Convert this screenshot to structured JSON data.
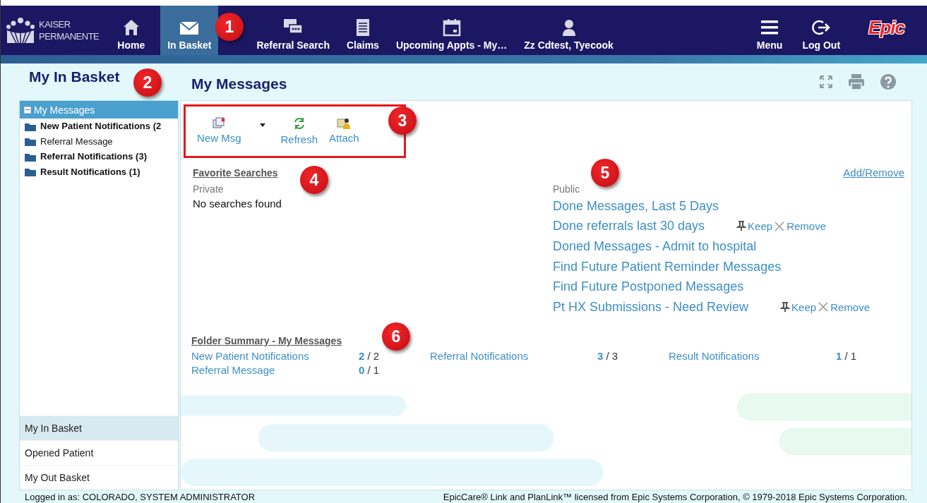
{
  "header": {
    "logo_text": "KAISER PERMANENTE",
    "nav": [
      {
        "label": "Home",
        "selected": false
      },
      {
        "label": "In Basket",
        "selected": true
      },
      {
        "label": "Referral Search",
        "selected": false
      },
      {
        "label": "Claims",
        "selected": false
      },
      {
        "label": "Upcoming Appts - My…",
        "selected": false
      },
      {
        "label": "Zz Cdtest, Tyecook",
        "selected": false
      }
    ],
    "actions": [
      {
        "label": "Menu"
      },
      {
        "label": "Log Out"
      }
    ],
    "brand": "Epic"
  },
  "sidebar": {
    "title": "My In Basket",
    "tree": [
      {
        "label": "My Messages",
        "expanded": true,
        "selected": true,
        "children": [
          {
            "label": "New Patient Notifications (2",
            "unread": true
          },
          {
            "label": "Referral Message",
            "unread": false
          },
          {
            "label": "Referral Notifications (3)",
            "unread": true
          },
          {
            "label": "Result Notifications (1)",
            "unread": true
          }
        ]
      }
    ],
    "tabs": [
      {
        "label": "My In Basket",
        "selected": true
      },
      {
        "label": "Opened Patient",
        "selected": false
      },
      {
        "label": "My Out Basket",
        "selected": false
      }
    ]
  },
  "main": {
    "title": "My Messages",
    "toolbar": {
      "highlighted": true,
      "buttons": [
        {
          "label": "New Msg",
          "has_menu": true
        },
        {
          "label": "Refresh",
          "has_menu": false
        },
        {
          "label": "Attach",
          "has_menu": false
        }
      ]
    },
    "favorite_searches": {
      "heading": "Favorite Searches",
      "add_remove": "Add/Remove",
      "private_label": "Private",
      "private_empty": "No searches found",
      "public_label": "Public",
      "public": [
        {
          "label": "Done Messages, Last 5 Days"
        },
        {
          "label": "Done referrals last 30 days",
          "keep": "Keep",
          "remove": "Remove"
        },
        {
          "label": "Doned Messages - Admit to hospital"
        },
        {
          "label": "Find Future Patient Reminder Messages"
        },
        {
          "label": "Find Future Postponed Messages"
        },
        {
          "label": "Pt HX Submissions - Need Review",
          "keep": "Keep",
          "remove": "Remove"
        }
      ]
    },
    "folder_summary": {
      "heading": "Folder Summary - My Messages",
      "folders": [
        {
          "name": "New Patient Notifications",
          "unread": "2",
          "total": "/ 2"
        },
        {
          "name": "Referral Notifications",
          "unread": "3",
          "total": "/ 3"
        },
        {
          "name": "Result Notifications",
          "unread": "1",
          "total": "/ 1"
        },
        {
          "name": "Referral Message",
          "unread": "0",
          "total": "/ 1"
        }
      ]
    }
  },
  "status_bar": {
    "left": "Logged in as: COLORADO, SYSTEM ADMINISTRATOR",
    "right": "EpicCare® Link and PlanLink™ licensed from Epic Systems Corporation, © 1979-2018 Epic Systems Corporation."
  },
  "callouts": [
    "1",
    "2",
    "3",
    "4",
    "5",
    "6"
  ]
}
